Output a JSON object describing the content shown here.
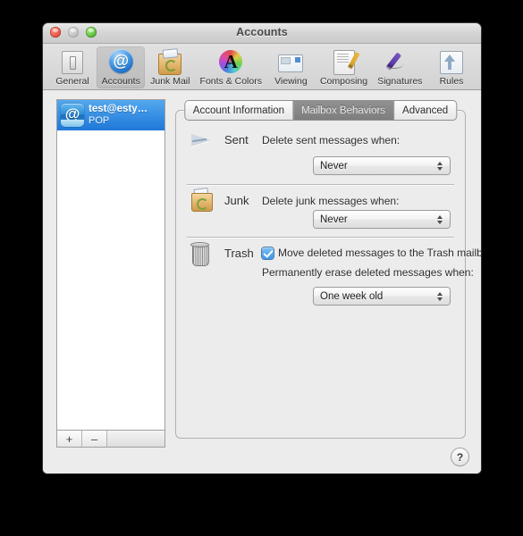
{
  "window": {
    "title": "Accounts",
    "traffic_lights": [
      "close-button",
      "minimize-button",
      "zoom-button"
    ]
  },
  "toolbar": {
    "items": [
      {
        "label": "General",
        "icon": "lightswitch-icon",
        "selected": false
      },
      {
        "label": "Accounts",
        "icon": "at-sign-icon",
        "selected": true
      },
      {
        "label": "Junk Mail",
        "icon": "junk-bag-icon",
        "selected": false
      },
      {
        "label": "Fonts & Colors",
        "icon": "color-wheel-a-icon",
        "selected": false
      },
      {
        "label": "Viewing",
        "icon": "viewing-icon",
        "selected": false
      },
      {
        "label": "Composing",
        "icon": "compose-pencil-icon",
        "selected": false
      },
      {
        "label": "Signatures",
        "icon": "signature-pen-icon",
        "selected": false
      },
      {
        "label": "Rules",
        "icon": "rules-arrows-icon",
        "selected": false
      }
    ]
  },
  "account_list": {
    "accounts": [
      {
        "name": "test@esty…",
        "type": "POP",
        "icon": "at-sign-account-icon",
        "selected": true
      }
    ],
    "add_label": "+",
    "remove_label": "–"
  },
  "tabs": [
    {
      "label": "Account Information",
      "active": false
    },
    {
      "label": "Mailbox Behaviors",
      "active": true
    },
    {
      "label": "Advanced",
      "active": false
    }
  ],
  "sections": {
    "sent": {
      "title": "Sent",
      "icon": "paper-plane-icon",
      "label": "Delete sent messages when:",
      "popup_value": "Never"
    },
    "junk": {
      "title": "Junk",
      "icon": "junk-bag-icon",
      "label": "Delete junk messages when:",
      "popup_value": "Never"
    },
    "trash": {
      "title": "Trash",
      "icon": "trash-can-icon",
      "checkbox_label": "Move deleted messages to the Trash mailbox",
      "checkbox_checked": true,
      "label": "Permanently erase deleted messages when:",
      "popup_value": "One week old"
    }
  },
  "help": {
    "label": "?"
  },
  "colors": {
    "selection_blue": "#2f8fd8",
    "window_bg": "#ececec",
    "active_tab_bg": "#868686"
  }
}
